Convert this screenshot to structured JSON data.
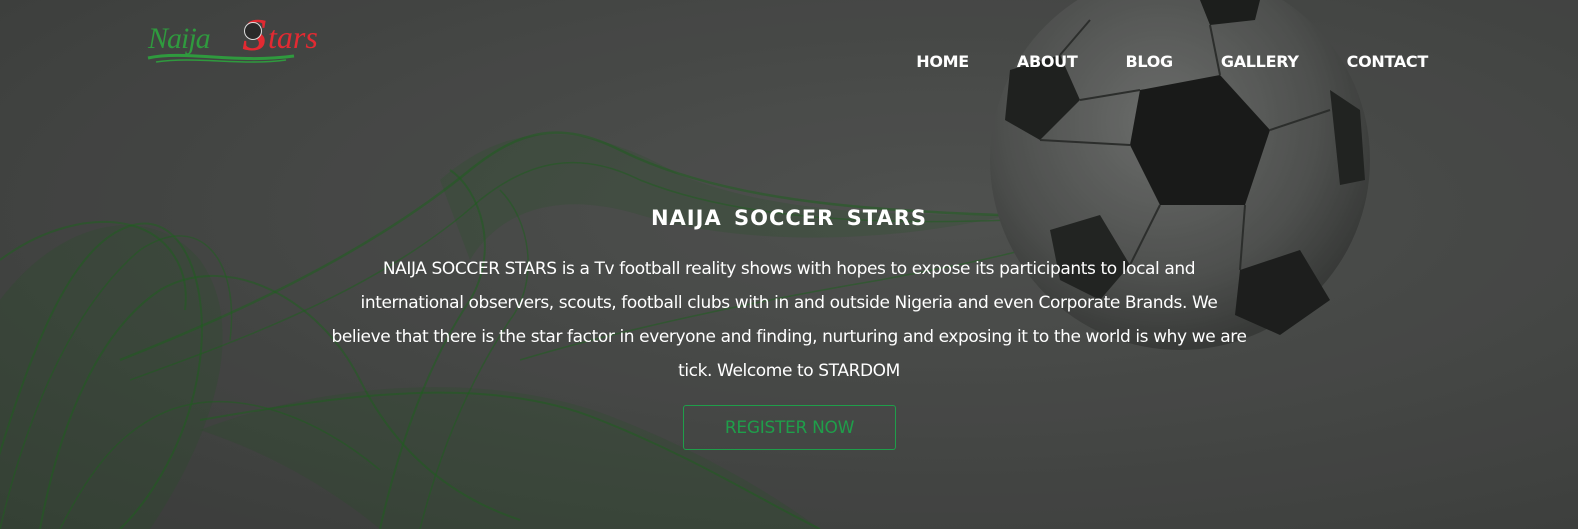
{
  "brand": {
    "logo_word_1": "Naija",
    "logo_word_2_initial": "S",
    "logo_word_2_rest": "tars",
    "logo_colors": {
      "green": "#2f9a3e",
      "red": "#e22a32"
    }
  },
  "nav": {
    "items": [
      {
        "label": "HOME"
      },
      {
        "label": "ABOUT"
      },
      {
        "label": "BLOG"
      },
      {
        "label": "GALLERY"
      },
      {
        "label": "CONTACT"
      }
    ]
  },
  "hero": {
    "title": "NAIJA SOCCER STARS",
    "description": "NAIJA SOCCER STARS is a Tv football reality shows with hopes to expose its participants to local and international observers, scouts, football clubs with in and outside Nigeria and even Corporate Brands. We believe that there is the star factor in everyone and finding, nurturing and exposing it to the world is why we are tick. Welcome to STARDOM",
    "cta_label": "REGISTER NOW",
    "accent_color": "#1f9e4a",
    "background_art": [
      "green-smoke-swirl",
      "soccer-ball"
    ]
  }
}
